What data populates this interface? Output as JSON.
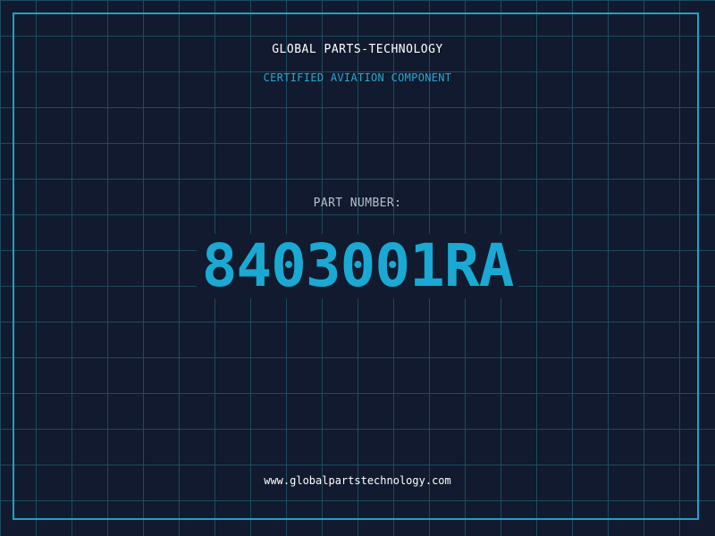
{
  "brand": {
    "name": "GLOBAL PARTS-TECHNOLOGY",
    "tagline": "CERTIFIED AVIATION COMPONENT"
  },
  "part": {
    "label": "PART NUMBER:",
    "number": "8403001RA"
  },
  "footer": {
    "website": "www.globalpartstechnology.com"
  },
  "colors": {
    "background": "#111a2e",
    "grid": "#1d4a5e",
    "accent": "#1aa9d2",
    "frame": "#1aa3c9"
  }
}
